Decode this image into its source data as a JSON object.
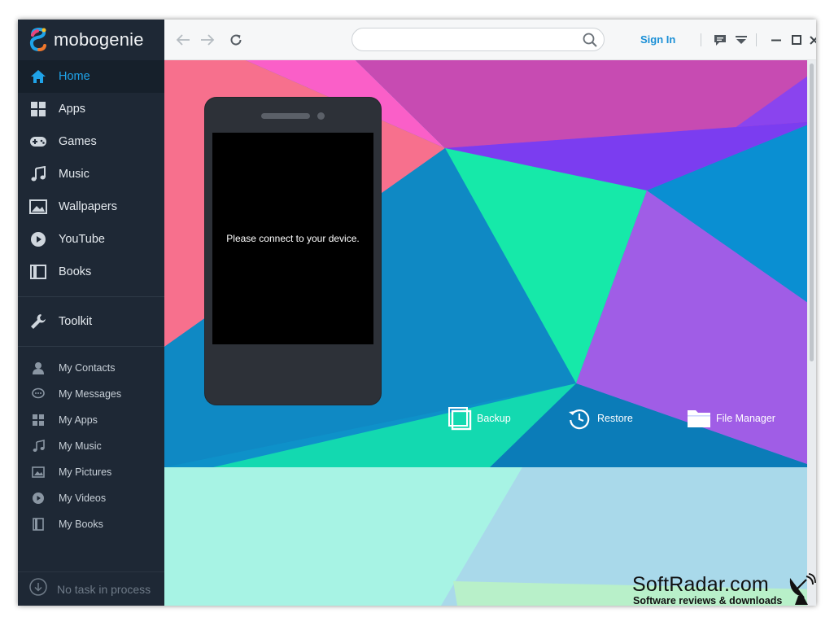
{
  "app": {
    "name": "mobogenie"
  },
  "sidebar": {
    "main": [
      {
        "label": "Home",
        "icon": "home-icon",
        "active": true
      },
      {
        "label": "Apps",
        "icon": "apps-grid-icon"
      },
      {
        "label": "Games",
        "icon": "gamepad-icon"
      },
      {
        "label": "Music",
        "icon": "music-note-icon"
      },
      {
        "label": "Wallpapers",
        "icon": "wallpaper-icon"
      },
      {
        "label": "YouTube",
        "icon": "play-icon"
      },
      {
        "label": "Books",
        "icon": "book-icon"
      }
    ],
    "toolkit": {
      "label": "Toolkit",
      "icon": "wrench-icon"
    },
    "my": [
      {
        "label": "My Contacts",
        "icon": "contact-icon"
      },
      {
        "label": "My Messages",
        "icon": "message-icon"
      },
      {
        "label": "My Apps",
        "icon": "apps-grid-icon"
      },
      {
        "label": "My Music",
        "icon": "music-note-icon"
      },
      {
        "label": "My Pictures",
        "icon": "picture-icon"
      },
      {
        "label": "My Videos",
        "icon": "play-icon"
      },
      {
        "label": "My Books",
        "icon": "book-icon"
      }
    ],
    "task_status": "No task in process"
  },
  "toolbar": {
    "search_placeholder": "",
    "sign_in": "Sign In"
  },
  "device": {
    "message": "Please connect to your device."
  },
  "actions": {
    "backup": "Backup",
    "restore": "Restore",
    "file_manager": "File Manager"
  },
  "watermark": {
    "brand": "SoftRadar.com",
    "tagline": "Software reviews & downloads"
  },
  "colors": {
    "sidebar_bg": "#1e2835",
    "accent": "#1fa3e8",
    "signin": "#1a8fd6"
  }
}
